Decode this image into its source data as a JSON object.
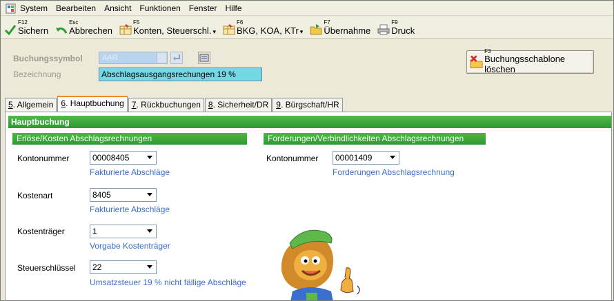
{
  "menu": {
    "items": [
      "System",
      "Bearbeiten",
      "Ansicht",
      "Funktionen",
      "Fenster",
      "Hilfe"
    ]
  },
  "toolbar": {
    "save": {
      "key": "F12",
      "label": "Sichern"
    },
    "cancel": {
      "key": "Esc",
      "label": "Abbrechen"
    },
    "accounts": {
      "key": "F5",
      "label": "Konten, Steuerschl."
    },
    "bkg": {
      "key": "F6",
      "label": "BKG, KOA, KTr"
    },
    "takeover": {
      "key": "F7",
      "label": "Übernahme"
    },
    "print": {
      "key": "F9",
      "label": "Druck"
    }
  },
  "header": {
    "symbol_label": "Buchungssymbol",
    "symbol_value": "AAR",
    "description_label": "Bezeichnung",
    "description_value": "Abschlagsausgangsrechungen 19 %",
    "delete_button": {
      "key": "F3",
      "label": "Buchungsschablone löschen"
    }
  },
  "tabs": [
    {
      "hotkey": "5",
      "label": ". Allgemein"
    },
    {
      "hotkey": "6",
      "label": ". Hauptbuchung"
    },
    {
      "hotkey": "7",
      "label": ". Rückbuchungen"
    },
    {
      "hotkey": "8",
      "label": ". Sicherheit/DR"
    },
    {
      "hotkey": "9",
      "label": ". Bürgschaft/HR"
    }
  ],
  "panel": {
    "title": "Hauptbuchung",
    "left_section": {
      "title": "Erlöse/Kosten Abschlagsrechnungen",
      "fields": [
        {
          "label": "Kontonummer",
          "value": "00008405",
          "description": "Fakturierte Abschläge"
        },
        {
          "label": "Kostenart",
          "value": "8405",
          "description": "Fakturierte Abschläge"
        },
        {
          "label": "Kostenträger",
          "value": "1",
          "description": "Vorgabe Kostenträger"
        },
        {
          "label": "Steuerschlüssel",
          "value": "22",
          "description": "Umsatzsteuer 19 % nicht fällige Abschläge"
        }
      ]
    },
    "right_section": {
      "title": "Forderungen/Verbindlichkeiten Abschlagsrechnungen",
      "fields": [
        {
          "label": "Kontonummer",
          "value": "00001409",
          "description": "Forderungen Abschlagsrechnung"
        }
      ]
    }
  },
  "colors": {
    "green_header": "#36a33a",
    "cyan_field": "#73d7e6",
    "link_blue": "#3a6fcf"
  }
}
